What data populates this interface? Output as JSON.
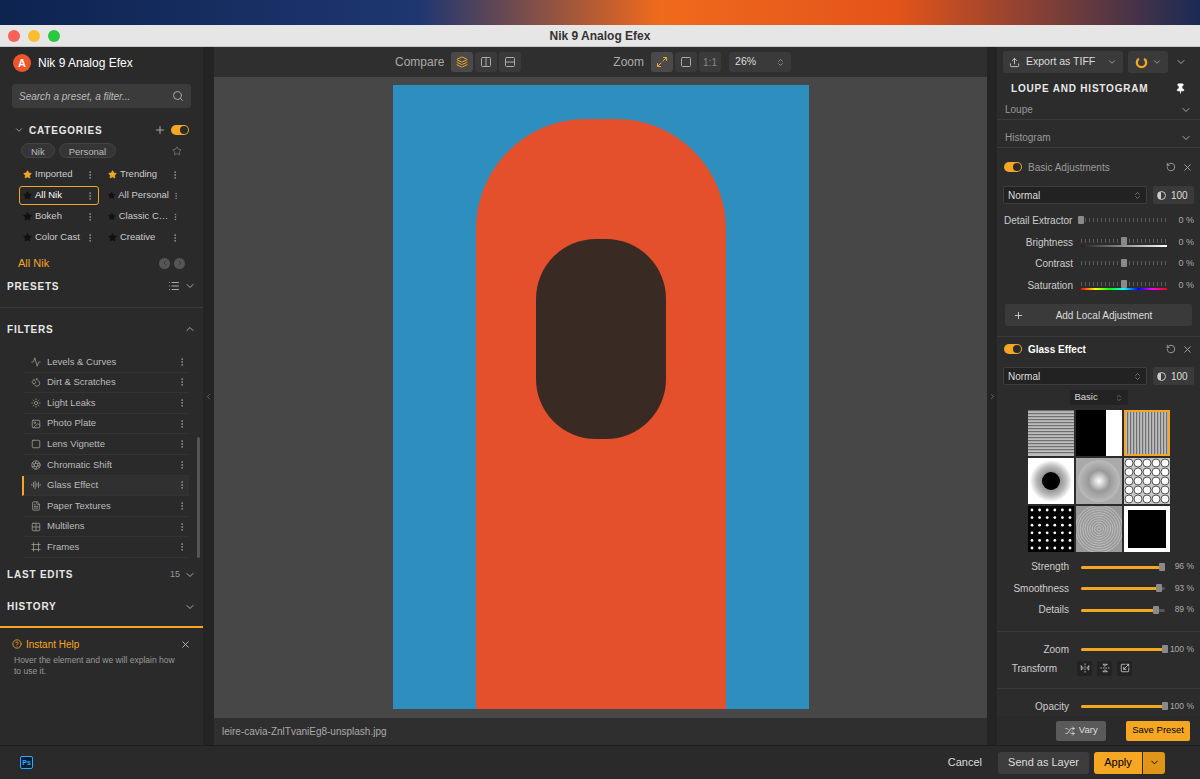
{
  "window": {
    "title": "Nik 9 Analog Efex"
  },
  "sidebar": {
    "logo_letter": "A",
    "app_name": "Nik 9 Analog Efex",
    "search": {
      "placeholder": "Search a preset, a filter..."
    },
    "categories": {
      "title": "CATEGORIES",
      "toggle_on": true,
      "tags": [
        {
          "label": "Nik",
          "selected": false
        },
        {
          "label": "Personal",
          "selected": false
        }
      ],
      "items": [
        {
          "label": "Imported",
          "starred": true,
          "selected": false
        },
        {
          "label": "Trending",
          "starred": true,
          "selected": false
        },
        {
          "label": "All Nik",
          "starred": false,
          "selected": true
        },
        {
          "label": "All Personal",
          "starred": false,
          "selected": false
        },
        {
          "label": "Bokeh",
          "starred": false,
          "selected": false
        },
        {
          "label": "Classic C…",
          "starred": false,
          "selected": false
        },
        {
          "label": "Color Cast",
          "starred": false,
          "selected": false
        },
        {
          "label": "Creative",
          "starred": false,
          "selected": false
        }
      ]
    },
    "current_category": "All Nik",
    "presets": {
      "title": "PRESETS",
      "expanded": false
    },
    "filters": {
      "title": "FILTERS",
      "expanded": true,
      "items": [
        {
          "label": "Levels & Curves",
          "selected": false
        },
        {
          "label": "Dirt & Scratches",
          "selected": false
        },
        {
          "label": "Light Leaks",
          "selected": false
        },
        {
          "label": "Photo Plate",
          "selected": false
        },
        {
          "label": "Lens Vignette",
          "selected": false
        },
        {
          "label": "Chromatic Shift",
          "selected": false
        },
        {
          "label": "Glass Effect",
          "selected": true
        },
        {
          "label": "Paper Textures",
          "selected": false
        },
        {
          "label": "Multilens",
          "selected": false
        },
        {
          "label": "Frames",
          "selected": false
        }
      ]
    },
    "last_edits": {
      "title": "LAST EDITS",
      "count": "15",
      "expanded": false
    },
    "history": {
      "title": "HISTORY",
      "expanded": false
    },
    "instant_help": {
      "title": "Instant Help",
      "text": "Hover the element and we will explain how to use it."
    }
  },
  "toolbar": {
    "compare": {
      "label": "Compare",
      "modes": [
        {
          "kind": "overlay",
          "selected": true
        },
        {
          "kind": "split",
          "selected": false
        },
        {
          "kind": "stack",
          "selected": false
        }
      ]
    },
    "zoom": {
      "label": "Zoom",
      "modes": [
        {
          "kind": "fit",
          "label": "",
          "selected": true
        },
        {
          "kind": "fill",
          "label": "",
          "selected": false
        },
        {
          "kind": "text",
          "label": "1:1",
          "selected": false
        }
      ],
      "value": "26%"
    }
  },
  "canvas": {
    "filename": "leire-cavia-ZnlTvaniEg8-unsplash.jpg"
  },
  "right_panel": {
    "export_label": "Export as TIFF",
    "loupe_histogram": {
      "title": "LOUPE AND HISTOGRAM",
      "pinned": true,
      "items": [
        {
          "label": "Loupe",
          "expanded": false
        },
        {
          "label": "Histogram",
          "expanded": false
        }
      ]
    },
    "basic": {
      "title": "Basic Adjustments",
      "on": true,
      "blend_mode": "Normal",
      "opacity": "100",
      "sliders": [
        {
          "label": "Detail Extractor",
          "reading": "0 %",
          "level": 0,
          "kind": "plain"
        },
        {
          "label": "Brightness",
          "reading": "0 %",
          "level": 0.5,
          "kind": "gray"
        },
        {
          "label": "Contrast",
          "reading": "0 %",
          "level": 0.5,
          "kind": "plain"
        },
        {
          "label": "Saturation",
          "reading": "0 %",
          "level": 0.5,
          "kind": "hue"
        }
      ],
      "add_local": "Add Local Adjustment"
    },
    "glass": {
      "title": "Glass Effect",
      "on": true,
      "blend_mode": "Normal",
      "opacity": "100",
      "preset_group": "Basic",
      "textures": [
        {
          "kind": "hlines",
          "selected": false
        },
        {
          "kind": "split",
          "selected": false
        },
        {
          "kind": "vlines",
          "selected": true
        },
        {
          "kind": "ring",
          "selected": false
        },
        {
          "kind": "radial",
          "selected": false
        },
        {
          "kind": "bigdots",
          "selected": false
        },
        {
          "kind": "dots",
          "selected": false
        },
        {
          "kind": "concentric",
          "selected": false
        },
        {
          "kind": "frame",
          "selected": false
        }
      ],
      "sliders": [
        {
          "label": "Strength",
          "reading": "96 %",
          "level": 0.96
        },
        {
          "label": "Smoothness",
          "reading": "93 %",
          "level": 0.93
        },
        {
          "label": "Details",
          "reading": "89 %",
          "level": 0.89
        }
      ],
      "zoom": {
        "label": "Zoom",
        "reading": "100 %",
        "level": 1
      },
      "transform": {
        "label": "Transform"
      },
      "opacity_slider": {
        "label": "Opacity",
        "reading": "100 %",
        "level": 1
      }
    },
    "vary": "Vary",
    "save_preset": "Save Preset"
  },
  "bottom_bar": {
    "ps_badge": "Ps",
    "cancel": "Cancel",
    "send_as_layer": "Send as Layer",
    "apply": "Apply"
  }
}
